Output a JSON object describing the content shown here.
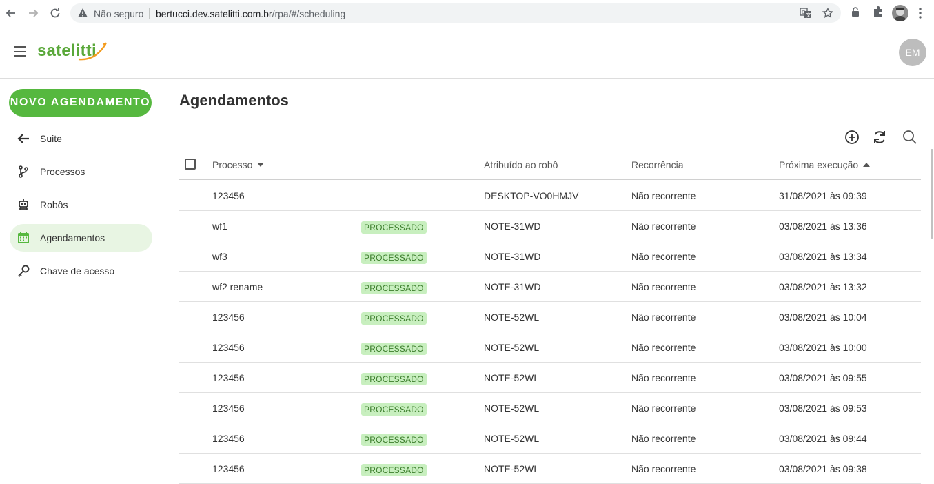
{
  "browser": {
    "security_label": "Não seguro",
    "url_host": "bertucci.dev.satelitti.com.br",
    "url_path": "/rpa/#/scheduling"
  },
  "header": {
    "logo_text": "satelitti",
    "avatar_initials": "EM"
  },
  "sidebar": {
    "new_button": "NOVO AGENDAMENTO",
    "items": [
      {
        "label": "Suite",
        "icon": "arrow-left-icon"
      },
      {
        "label": "Processos",
        "icon": "branch-icon"
      },
      {
        "label": "Robôs",
        "icon": "robot-icon"
      },
      {
        "label": "Agendamentos",
        "icon": "calendar-icon",
        "active": true
      },
      {
        "label": "Chave de acesso",
        "icon": "key-icon"
      }
    ]
  },
  "main": {
    "title": "Agendamentos",
    "columns": {
      "process": "Processo",
      "robot": "Atribuído ao robô",
      "recurrence": "Recorrência",
      "next_run": "Próxima execução"
    },
    "rows": [
      {
        "process": "123456",
        "status": "",
        "robot": "DESKTOP-VO0HMJV",
        "recurrence": "Não recorrente",
        "next_run": "31/08/2021 às 09:39"
      },
      {
        "process": "wf1",
        "status": "PROCESSADO",
        "robot": "NOTE-31WD",
        "recurrence": "Não recorrente",
        "next_run": "03/08/2021 às 13:36"
      },
      {
        "process": "wf3",
        "status": "PROCESSADO",
        "robot": "NOTE-31WD",
        "recurrence": "Não recorrente",
        "next_run": "03/08/2021 às 13:34"
      },
      {
        "process": "wf2 rename",
        "status": "PROCESSADO",
        "robot": "NOTE-31WD",
        "recurrence": "Não recorrente",
        "next_run": "03/08/2021 às 13:32"
      },
      {
        "process": "123456",
        "status": "PROCESSADO",
        "robot": "NOTE-52WL",
        "recurrence": "Não recorrente",
        "next_run": "03/08/2021 às 10:04"
      },
      {
        "process": "123456",
        "status": "PROCESSADO",
        "robot": "NOTE-52WL",
        "recurrence": "Não recorrente",
        "next_run": "03/08/2021 às 10:00"
      },
      {
        "process": "123456",
        "status": "PROCESSADO",
        "robot": "NOTE-52WL",
        "recurrence": "Não recorrente",
        "next_run": "03/08/2021 às 09:55"
      },
      {
        "process": "123456",
        "status": "PROCESSADO",
        "robot": "NOTE-52WL",
        "recurrence": "Não recorrente",
        "next_run": "03/08/2021 às 09:53"
      },
      {
        "process": "123456",
        "status": "PROCESSADO",
        "robot": "NOTE-52WL",
        "recurrence": "Não recorrente",
        "next_run": "03/08/2021 às 09:44"
      },
      {
        "process": "123456",
        "status": "PROCESSADO",
        "robot": "NOTE-52WL",
        "recurrence": "Não recorrente",
        "next_run": "03/08/2021 às 09:38"
      }
    ]
  },
  "colors": {
    "brand_green": "#56b83f",
    "badge_bg": "#c8efbf",
    "badge_text": "#3b7d2b",
    "active_bg": "#e8f5e3"
  }
}
